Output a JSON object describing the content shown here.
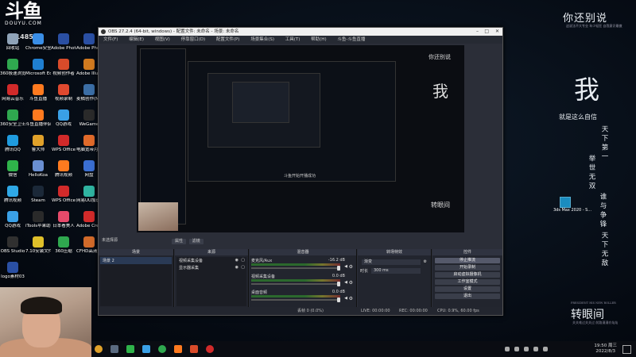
{
  "douyu": {
    "logo": "斗鱼",
    "sub": "DOUYU.COM",
    "room": "6148591"
  },
  "desktop_icons": [
    {
      "label": "回收站",
      "color": "#8fa3b8"
    },
    {
      "label": "Chrome安全浏览器",
      "color": "#3a8ee6"
    },
    {
      "label": "Adobe Photosh...",
      "color": "#2a4fa3"
    },
    {
      "label": "Adobe Photosh...",
      "color": "#2a4fa3"
    },
    {
      "label": "360极速浏览器",
      "color": "#2fa84f"
    },
    {
      "label": "Microsoft Edge",
      "color": "#1f7fd1"
    },
    {
      "label": "视频创作者",
      "color": "#d94b2a"
    },
    {
      "label": "Adobe Illustrat...",
      "color": "#d17a1f"
    },
    {
      "label": "网易云音乐",
      "color": "#d12a2a"
    },
    {
      "label": "斗鱼直播",
      "color": "#ff7a1f"
    },
    {
      "label": "视频录制",
      "color": "#e0492f"
    },
    {
      "label": "麦橘创作(Mailong...",
      "color": "#3b6ea5"
    },
    {
      "label": "360安全卫士",
      "color": "#2fa84f"
    },
    {
      "label": "斗鱼直播伴侣",
      "color": "#ff7a1f"
    },
    {
      "label": "QQ游戏",
      "color": "#3aa0e6"
    },
    {
      "label": "WeGame",
      "color": "#2a2a2a"
    },
    {
      "label": "腾讯QQ",
      "color": "#1f9bde"
    },
    {
      "label": "鲁大师",
      "color": "#e0a12a"
    },
    {
      "label": "WPS Office",
      "color": "#d12a2a"
    },
    {
      "label": "电脑宽带月光",
      "color": "#e06a2a"
    },
    {
      "label": "微信",
      "color": "#2fb34a"
    },
    {
      "label": "HelloKoa",
      "color": "#6a8fd1"
    },
    {
      "label": "腾讯视频",
      "color": "#ff7a1f"
    },
    {
      "label": "网盘",
      "color": "#3a6ed1"
    },
    {
      "label": "腾讯视频",
      "color": "#2fa8e6"
    },
    {
      "label": "Steam",
      "color": "#1b2838"
    },
    {
      "label": "WPS Office",
      "color": "#d12a2a"
    },
    {
      "label": "网易UU加速器",
      "color": "#2fb3a0"
    },
    {
      "label": "QQ游戏",
      "color": "#3aa0e6"
    },
    {
      "label": "iTools苹果助手",
      "color": "#2a2a2a"
    },
    {
      "label": "日本看美人",
      "color": "#e64a6a"
    },
    {
      "label": "Adobe Creat...",
      "color": "#d12a2a"
    },
    {
      "label": "OBS Studio",
      "color": "#303030"
    },
    {
      "label": "7.10安装文件",
      "color": "#e0c02a"
    },
    {
      "label": "360压缩",
      "color": "#2fa84f"
    },
    {
      "label": "CFHD高清竞技大区",
      "color": "#d16a2a"
    },
    {
      "label": "logo素材03",
      "color": "#2a4fa3"
    }
  ],
  "wallpaper": {
    "title": "你还别说",
    "subtitle": "这说法不大专业 年少轻狂 自我意识最傲",
    "big_char": "我",
    "line1": "就是这么自信",
    "col1": "天下第一",
    "col2": "举世无双",
    "col3": "谁与争锋",
    "col4": "天下无敌",
    "bottom": "转眼间",
    "bottom_sub": "PRESIDENT HIS NEW ROLLER",
    "bottom_sub2": "关关难过关关过 前路漫漫亦灿灿"
  },
  "desktop_extra": {
    "max_label": "3ds Max 2020 - S..."
  },
  "obs": {
    "title": "OBS 27.2.4 (64-bit, windows) - 配置文件: 未命名 - 场景: 未命名",
    "menu": [
      "文件(F)",
      "编辑(E)",
      "视图(V)",
      "停靠窗口(D)",
      "配置文件(P)",
      "场景集合(S)",
      "工具(T)",
      "帮助(H)",
      "斗鱼-斗鱼直播"
    ],
    "scene_label": "未选择源",
    "scene_btns": [
      "属性",
      "滤镜"
    ],
    "docks": {
      "scenes": {
        "title": "场景",
        "items": [
          "场景 2"
        ]
      },
      "sources": {
        "title": "来源",
        "items": [
          "视频采集设备",
          "显示器采集"
        ]
      },
      "mixer": {
        "title": "混音器",
        "rows": [
          {
            "name": "麦克风/Aux",
            "db": "-16.2 dB"
          },
          {
            "name": "视频采集设备",
            "db": "0.0 dB"
          },
          {
            "name": "桌面音频",
            "db": "0.0 dB"
          }
        ]
      },
      "transitions": {
        "title": "转场特效",
        "type": "渐变",
        "duration_label": "时长",
        "duration": "300 ms"
      },
      "controls": {
        "title": "控件",
        "buttons": [
          "停止推流",
          "开始录制",
          "启动虚拟摄像机",
          "工作室模式",
          "设置",
          "退出"
        ]
      }
    },
    "status": {
      "drop": "丢帧 0 (0.0%)",
      "live": "LIVE: 00:00:00",
      "rec": "REC: 00:00:00",
      "cpu": "CPU: 0.9%, 60.00 fps"
    },
    "preview_text": {
      "tag": "斗鱼开始开播成功"
    }
  },
  "taskbar": {
    "time": "19:50 周三",
    "date": "2022/8/3"
  }
}
